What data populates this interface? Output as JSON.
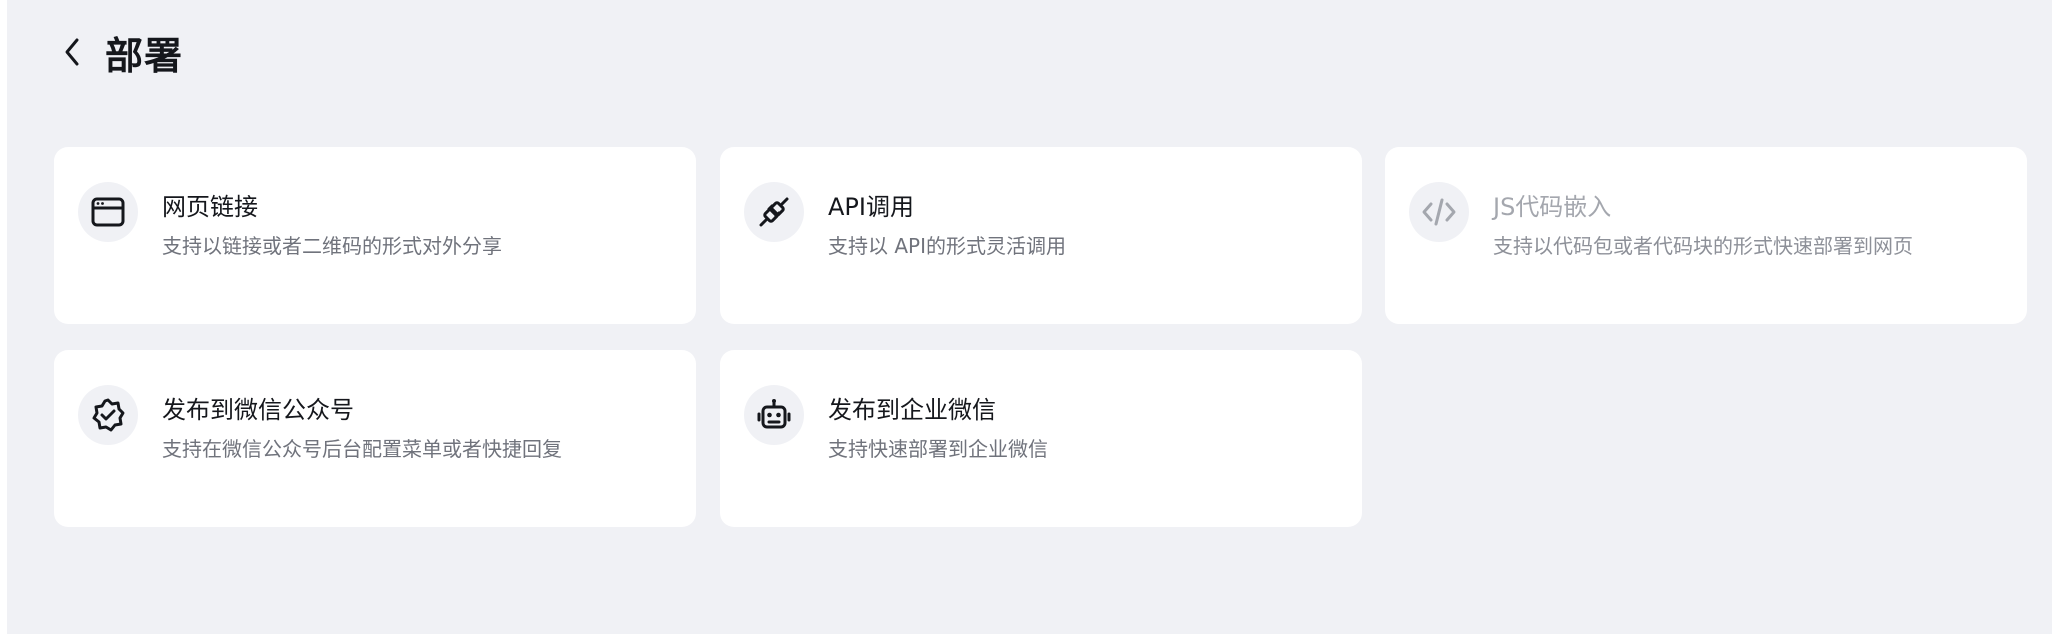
{
  "header": {
    "title": "部署",
    "back_icon": "chevron-left-icon"
  },
  "colors": {
    "background": "#f0f1f5",
    "card": "#ffffff",
    "text": "#15171c",
    "muted": "#70737c",
    "disabled": "#a4a7ae"
  },
  "cards": [
    {
      "title": "网页链接",
      "desc": "支持以链接或者二维码的形式对外分享",
      "icon": "browser-window-icon",
      "disabled": false
    },
    {
      "title": "API调用",
      "desc": "支持以 API的形式灵活调用",
      "icon": "plug-connect-icon",
      "disabled": false
    },
    {
      "title": "JS代码嵌入",
      "desc": "支持以代码包或者代码块的形式快速部署到网页",
      "icon": "code-icon",
      "disabled": true
    },
    {
      "title": "发布到微信公众号",
      "desc": "支持在微信公众号后台配置菜单或者快捷回复",
      "icon": "verified-badge-icon",
      "disabled": false
    },
    {
      "title": "发布到企业微信",
      "desc": "支持快速部署到企业微信",
      "icon": "robot-icon",
      "disabled": false
    }
  ]
}
